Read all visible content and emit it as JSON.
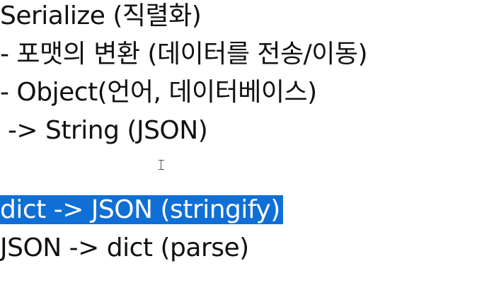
{
  "document": {
    "lines": [
      "Serialize (직렬화)",
      "- 포맷의 변환 (데이터를 전송/이동)",
      "- Object(언어, 데이터베이스)",
      " -> String (JSON)",
      "",
      "dict -> JSON (stringify)",
      "JSON -> dict (parse)"
    ],
    "selected_line_index": 5
  },
  "colors": {
    "selection": "#0f6fd6",
    "text": "#111111",
    "background": "#ffffff"
  },
  "icons": {
    "cursor": "text-cursor-icon"
  }
}
